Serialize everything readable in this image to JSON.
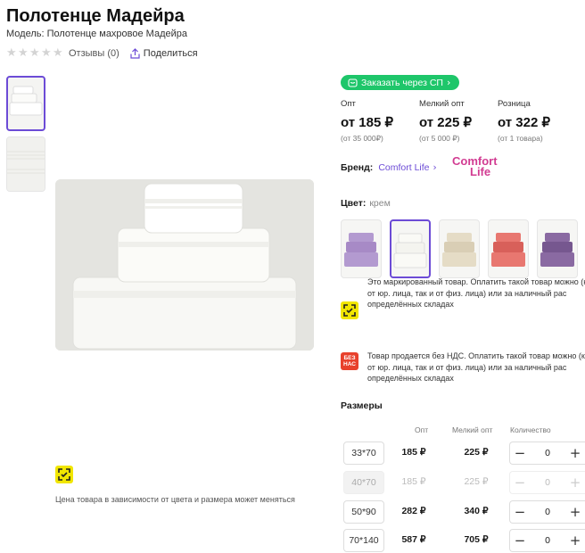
{
  "product": {
    "title": "Полотенце Мадейра",
    "model": "Модель: Полотенце махровое Мадейра",
    "reviews": "Отзывы (0)",
    "share": "Поделиться",
    "price_note": "Цена товара в зависимости от цвета и размера может меняться"
  },
  "order_sp": "Заказать через СП",
  "prices": [
    {
      "label": "Опт",
      "value": "от 185 ₽",
      "sub": "(от 35 000₽)"
    },
    {
      "label": "Мелкий опт",
      "value": "от 225 ₽",
      "sub": "(от 5 000 ₽)"
    },
    {
      "label": "Розница",
      "value": "от 322 ₽",
      "sub": "(от 1 товара)"
    }
  ],
  "brand": {
    "label": "Бренд:",
    "name": "Comfort Life",
    "logo_text": "Comfort",
    "logo_text2": "Life"
  },
  "color": {
    "label": "Цвет:",
    "value": "крем"
  },
  "swatch_colors": [
    "#b39ad0",
    "#efefea",
    "#ddd3bd",
    "#e06a64",
    "#7e5d96"
  ],
  "notices": [
    {
      "text": "Это маркированный товар. Оплатить такой товар можно (как от юр. лица, так и от физ. лица) или за наличный рас определённых складах",
      "icon": "marking-icon"
    },
    {
      "text": "Товар продается без НДС. Оплатить такой товар можно (как от юр. лица, так и от физ. лица) или за наличный рас определённых складах",
      "icon": "no-vat-icon",
      "icon_text": "БЕЗ НАС"
    }
  ],
  "sizes": {
    "title": "Размеры",
    "headers": {
      "opt": "Опт",
      "small_opt": "Мелкий опт",
      "qty": "Количество"
    },
    "rows": [
      {
        "size": "33*70",
        "opt": "185 ₽",
        "small_opt": "225 ₽",
        "qty": "0"
      },
      {
        "size": "40*70",
        "opt": "185 ₽",
        "small_opt": "225 ₽",
        "qty": "0"
      },
      {
        "size": "50*90",
        "opt": "282 ₽",
        "small_opt": "340 ₽",
        "qty": "0"
      },
      {
        "size": "70*140",
        "opt": "587 ₽",
        "small_opt": "705 ₽",
        "qty": "0"
      }
    ]
  }
}
